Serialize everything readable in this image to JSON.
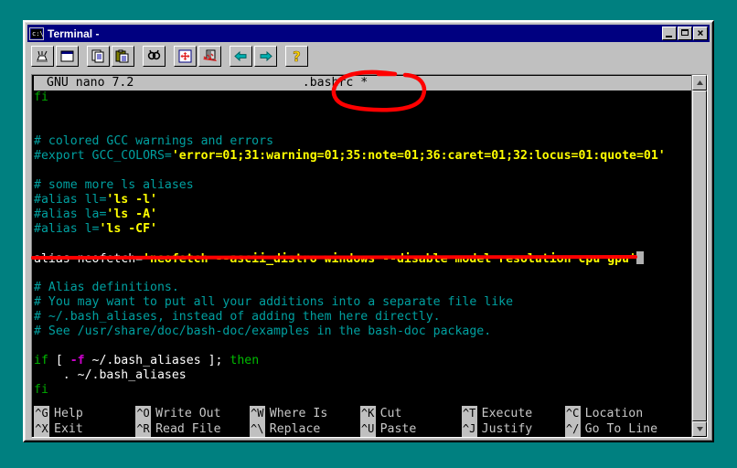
{
  "window": {
    "title": "Terminal -",
    "icon": "terminal-icon",
    "buttons": {
      "minimize": "minimize-button",
      "maximize": "maximize-button",
      "close": "close-button"
    }
  },
  "toolbar": {
    "items": [
      {
        "name": "new-session-icon",
        "label": "New Session"
      },
      {
        "name": "new-window-icon",
        "label": "New Window"
      },
      {
        "name": "copy-icon",
        "label": "Copy"
      },
      {
        "name": "paste-icon",
        "label": "Paste"
      },
      {
        "name": "find-icon",
        "label": "Find"
      },
      {
        "name": "move-icon",
        "label": "Move"
      },
      {
        "name": "kill-icon",
        "label": "Kill"
      },
      {
        "name": "back-arrow-icon",
        "label": "Back"
      },
      {
        "name": "forward-arrow-icon",
        "label": "Forward"
      },
      {
        "name": "help-icon",
        "label": "Help"
      }
    ]
  },
  "editor": {
    "app_version": "GNU nano 7.2",
    "filename": ".bashrc *",
    "lines": [
      {
        "id": "line-fi-top",
        "segments": [
          {
            "t": "fi",
            "c": "grn"
          }
        ]
      },
      {
        "id": "line-blank-1",
        "segments": [
          {
            "t": "",
            "c": "plain"
          }
        ]
      },
      {
        "id": "line-blank-2",
        "segments": [
          {
            "t": "",
            "c": "plain"
          }
        ]
      },
      {
        "id": "line-gcc-comment",
        "segments": [
          {
            "t": "# colored GCC warnings and errors",
            "c": "cmt"
          }
        ]
      },
      {
        "id": "line-gcc-colors",
        "segments": [
          {
            "t": "#export GCC_COLORS=",
            "c": "cmt"
          },
          {
            "t": "'error=01;31:warning=01;35:note=01;36:caret=01;32:locus=01:quote=01'",
            "c": "str"
          }
        ]
      },
      {
        "id": "line-blank-3",
        "segments": [
          {
            "t": "",
            "c": "plain"
          }
        ]
      },
      {
        "id": "line-ls-aliases-comment",
        "segments": [
          {
            "t": "# some more ls aliases",
            "c": "cmt"
          }
        ]
      },
      {
        "id": "line-alias-ll",
        "segments": [
          {
            "t": "#alias ll=",
            "c": "cmt"
          },
          {
            "t": "'ls -l'",
            "c": "str"
          }
        ]
      },
      {
        "id": "line-alias-la",
        "segments": [
          {
            "t": "#alias la=",
            "c": "cmt"
          },
          {
            "t": "'ls -A'",
            "c": "str"
          }
        ]
      },
      {
        "id": "line-alias-l",
        "segments": [
          {
            "t": "#alias l=",
            "c": "cmt"
          },
          {
            "t": "'ls -CF'",
            "c": "str"
          }
        ]
      },
      {
        "id": "line-blank-4",
        "segments": [
          {
            "t": "",
            "c": "plain"
          }
        ]
      },
      {
        "id": "line-alias-neofetch",
        "highlighted": true,
        "segments": [
          {
            "t": "alias neofetch=",
            "c": "plain"
          },
          {
            "t": "'neofetch --ascii_distro windows --disable model resolution cpu gpu'",
            "c": "str"
          }
        ],
        "cursor": true
      },
      {
        "id": "line-blank-5",
        "segments": [
          {
            "t": "",
            "c": "plain"
          }
        ]
      },
      {
        "id": "line-alias-def-1",
        "segments": [
          {
            "t": "# Alias definitions.",
            "c": "cmt"
          }
        ]
      },
      {
        "id": "line-alias-def-2",
        "segments": [
          {
            "t": "# You may want to put all your additions into a separate file like",
            "c": "cmt"
          }
        ]
      },
      {
        "id": "line-alias-def-3",
        "segments": [
          {
            "t": "# ~/.bash_aliases, instead of adding them here directly.",
            "c": "cmt"
          }
        ]
      },
      {
        "id": "line-alias-def-4",
        "segments": [
          {
            "t": "# See /usr/share/doc/bash-doc/examples in the bash-doc package.",
            "c": "cmt"
          }
        ]
      },
      {
        "id": "line-blank-6",
        "segments": [
          {
            "t": "",
            "c": "plain"
          }
        ]
      },
      {
        "id": "line-if",
        "segments": [
          {
            "t": "if",
            "c": "kw"
          },
          {
            "t": " [ ",
            "c": "plain"
          },
          {
            "t": "-f",
            "c": "flag"
          },
          {
            "t": " ~/.bash_aliases ]; ",
            "c": "plain"
          },
          {
            "t": "then",
            "c": "kw"
          }
        ]
      },
      {
        "id": "line-source-aliases",
        "segments": [
          {
            "t": "    . ~/.bash_aliases",
            "c": "plain"
          }
        ]
      },
      {
        "id": "line-fi-bottom",
        "segments": [
          {
            "t": "fi",
            "c": "grn"
          }
        ]
      }
    ],
    "shortcuts": [
      [
        {
          "key": "^G",
          "label": "Help"
        },
        {
          "key": "^X",
          "label": "Exit"
        }
      ],
      [
        {
          "key": "^O",
          "label": "Write Out"
        },
        {
          "key": "^R",
          "label": "Read File"
        }
      ],
      [
        {
          "key": "^W",
          "label": "Where Is"
        },
        {
          "key": "^\\",
          "label": "Replace"
        }
      ],
      [
        {
          "key": "^K",
          "label": "Cut"
        },
        {
          "key": "^U",
          "label": "Paste"
        }
      ],
      [
        {
          "key": "^T",
          "label": "Execute"
        },
        {
          "key": "^J",
          "label": "Justify"
        }
      ],
      [
        {
          "key": "^C",
          "label": "Location"
        },
        {
          "key": "^/",
          "label": "Go To Line"
        }
      ]
    ]
  },
  "annotations": {
    "circle_target": ".bashrc *",
    "underline_target": "alias neofetch line",
    "color": "#ff0000"
  },
  "colors": {
    "desktop": "#008080",
    "window_face": "#c0c0c0",
    "titlebar": "#000080",
    "terminal_bg": "#000000",
    "comment": "#00a0a0",
    "string": "#ffff00",
    "keyword": "#00bb00",
    "flag": "#cc00cc",
    "annotation": "#ff0000"
  },
  "scrollbar": {
    "name": "vertical-scrollbar",
    "up": "scroll-up-arrow",
    "down": "scroll-down-arrow"
  }
}
